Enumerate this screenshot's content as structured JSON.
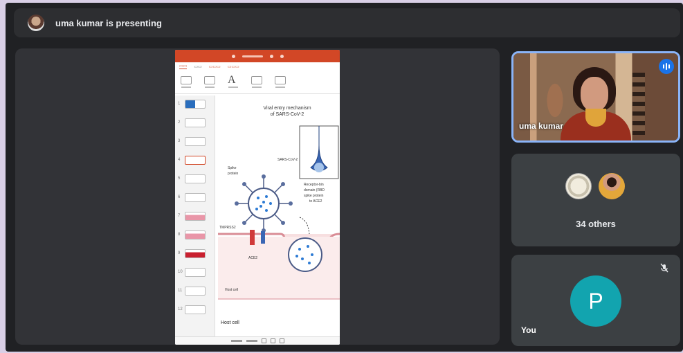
{
  "presenter_bar": {
    "text": "uma kumar is presenting",
    "avatar_icon": "presenter-avatar"
  },
  "slide": {
    "title_line1": "Viral entry mechanism",
    "title_line2": "of SARS-CoV-2",
    "label_virus": "SARS-CoV-2",
    "label_spike1": "Spike",
    "label_spike2": "protein",
    "label_tmprss2": "TMPRSS2",
    "label_ace2": "ACE2",
    "label_rbd1": "Receptor-bin",
    "label_rbd2": "domain (RBD",
    "label_rbd3": "spike protein",
    "label_rbd4": "to ACE2",
    "label_host_cell": "Host cell",
    "footer_text": "Host cell"
  },
  "thumbnails": [
    "1",
    "2",
    "3",
    "4",
    "5",
    "6",
    "7",
    "8",
    "9",
    "10",
    "11",
    "12"
  ],
  "participants": {
    "main_name": "uma kumar",
    "others_count": "34 others",
    "you_initial": "P",
    "you_label": "You"
  },
  "colors": {
    "speaking_border": "#8ab4f8",
    "you_avatar": "#12a4af",
    "ppt_accent": "#d24726"
  }
}
